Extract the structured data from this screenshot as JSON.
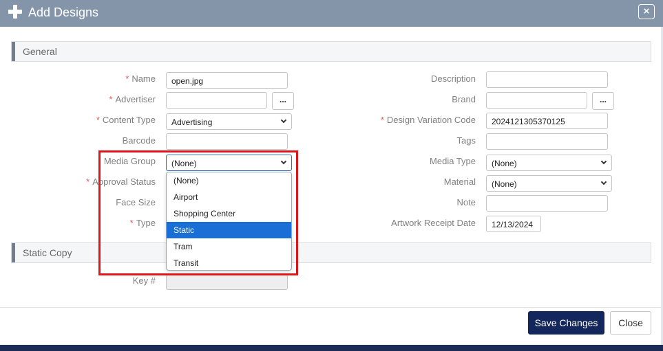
{
  "window": {
    "title": "Add Designs",
    "close_label": "×"
  },
  "sections": {
    "general": "General",
    "static_copy": "Static Copy"
  },
  "fields": {
    "name": {
      "label": "Name",
      "required": "*",
      "value": "open.jpg"
    },
    "advertiser": {
      "label": "Advertiser",
      "required": "*",
      "value": "",
      "button_label": "..."
    },
    "content_type": {
      "label": "Content Type",
      "required": "*",
      "value": "Advertising"
    },
    "barcode": {
      "label": "Barcode",
      "value": ""
    },
    "media_group": {
      "label": "Media Group",
      "value": "(None)"
    },
    "approval_status": {
      "label": "Approval Status",
      "required": "*"
    },
    "face_size": {
      "label": "Face Size"
    },
    "type": {
      "label": "Type",
      "required": "*"
    },
    "description": {
      "label": "Description",
      "value": ""
    },
    "brand": {
      "label": "Brand",
      "value": "",
      "button_label": "..."
    },
    "design_variation_code": {
      "label": "Design Variation Code",
      "required": "*",
      "value": "2024121305370125"
    },
    "tags": {
      "label": "Tags",
      "value": ""
    },
    "media_type": {
      "label": "Media Type",
      "value": "(None)"
    },
    "material": {
      "label": "Material",
      "value": "(None)"
    },
    "note": {
      "label": "Note",
      "value": ""
    },
    "artwork_receipt_date": {
      "label": "Artwork Receipt Date",
      "value": "12/13/2024"
    },
    "key_number": {
      "label": "Key #",
      "value": ""
    }
  },
  "media_group_dropdown": {
    "options": [
      "(None)",
      "Airport",
      "Shopping Center",
      "Static",
      "Tram",
      "Transit"
    ],
    "highlighted": "Static"
  },
  "footer": {
    "save_label": "Save Changes",
    "close_label": "Close"
  },
  "colors": {
    "titlebar": "#8595a9",
    "primary_button": "#14275c",
    "dropdown_highlight": "#1a6fd6",
    "annotation_box": "#e0151a",
    "required_marker": "#e25a5a"
  }
}
